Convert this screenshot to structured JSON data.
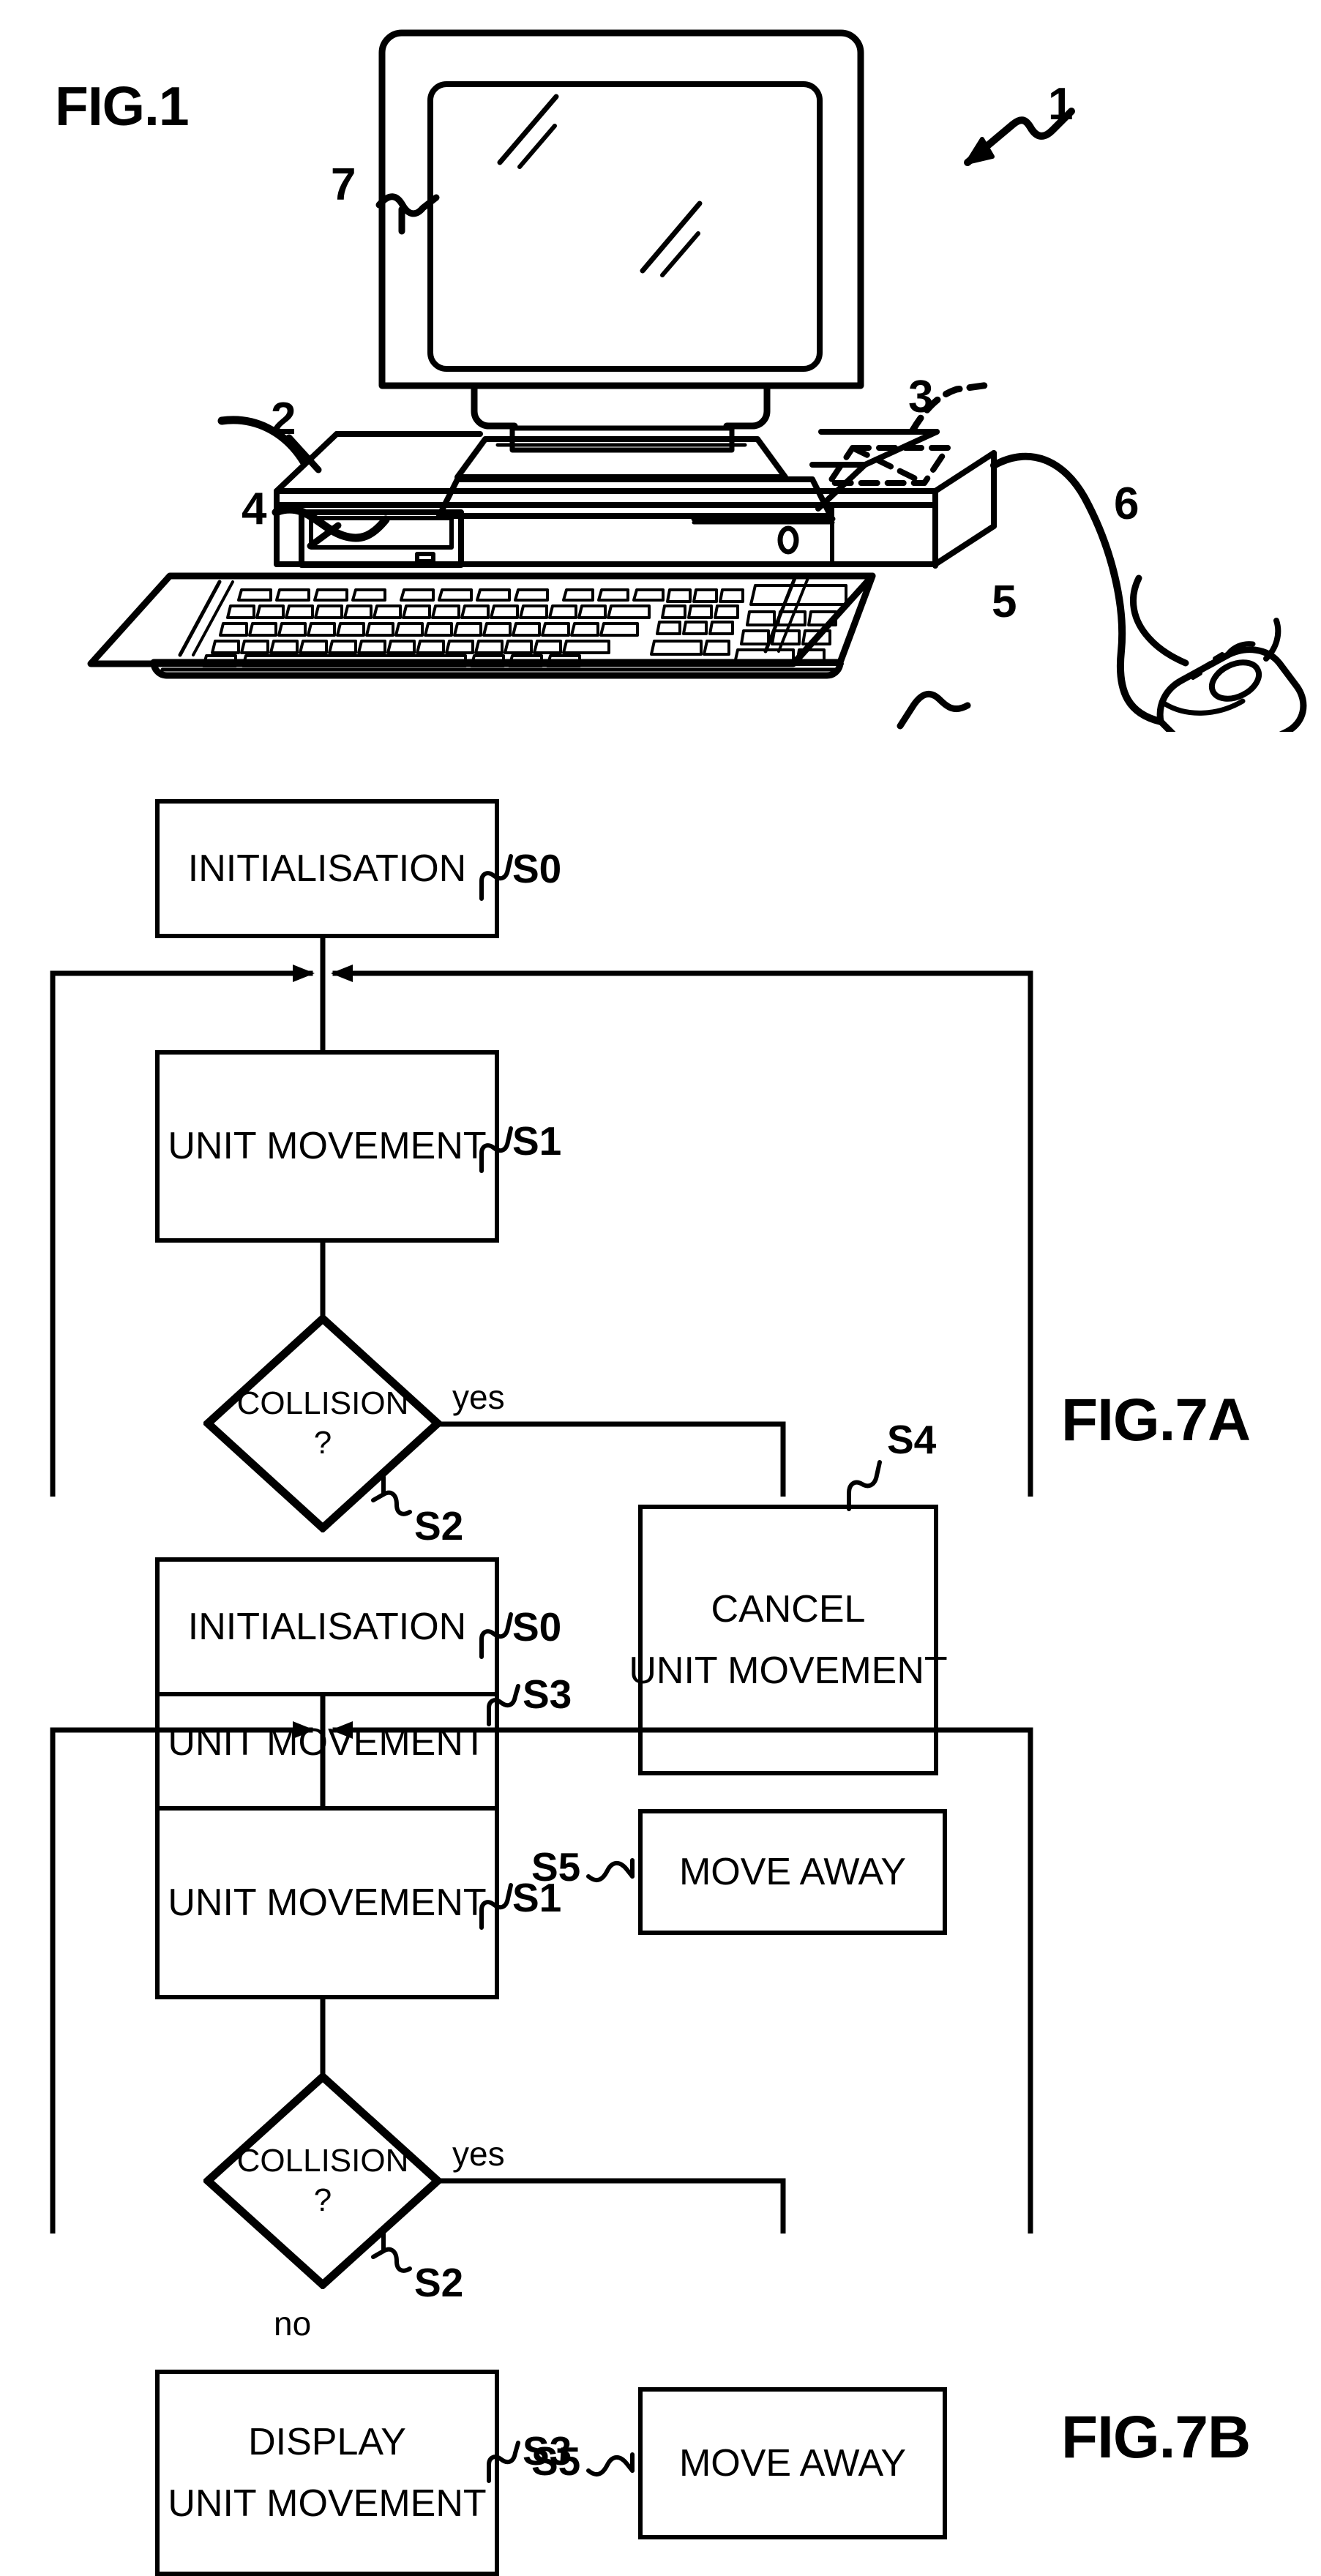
{
  "document": {
    "type": "patent-drawing-sheet",
    "figures": [
      "FIG.1",
      "FIG.7A",
      "FIG.7B"
    ]
  },
  "fig1": {
    "label": "FIG.1",
    "reference_numerals": [
      {
        "id": "1",
        "text": "1",
        "points_to": "whole computer system"
      },
      {
        "id": "2",
        "text": "2",
        "points_to": "computer base unit / housing"
      },
      {
        "id": "3",
        "text": "3",
        "points_to": "internal component (dashed outline)"
      },
      {
        "id": "4",
        "text": "4",
        "points_to": "disk drive slot"
      },
      {
        "id": "5",
        "text": "5",
        "points_to": "keyboard"
      },
      {
        "id": "6",
        "text": "6",
        "points_to": "mouse"
      },
      {
        "id": "7",
        "text": "7",
        "points_to": "monitor / display screen"
      }
    ]
  },
  "fig7a": {
    "label": "FIG.7A",
    "nodes": [
      {
        "step": "S0",
        "kind": "process",
        "lines": [
          "INITIALISATION"
        ]
      },
      {
        "step": "S1",
        "kind": "process",
        "lines": [
          "UNIT MOVEMENT"
        ]
      },
      {
        "step": "S2",
        "kind": "decision",
        "lines": [
          "COLLISION",
          "?"
        ]
      },
      {
        "step": "S3",
        "kind": "process",
        "lines": [
          "DISPLAY",
          "UNIT MOVEMENT"
        ]
      },
      {
        "step": "S4",
        "kind": "process",
        "lines": [
          "CANCEL",
          "UNIT MOVEMENT"
        ]
      },
      {
        "step": "S5",
        "kind": "process",
        "lines": [
          "MOVE AWAY"
        ]
      }
    ],
    "branch_labels": {
      "yes": "yes",
      "no": "no"
    },
    "step_labels": {
      "s0": "S0",
      "s1": "S1",
      "s2": "S2",
      "s3": "S3",
      "s4": "S4",
      "s5": "S5"
    },
    "box_text": {
      "initialisation": "INITIALISATION",
      "unit_movement": "UNIT MOVEMENT",
      "collision": "COLLISION",
      "question_mark": "?",
      "display_l1": "DISPLAY",
      "display_l2": "UNIT MOVEMENT",
      "cancel_l1": "CANCEL",
      "cancel_l2": "UNIT MOVEMENT",
      "move_away": "MOVE AWAY"
    }
  },
  "fig7b": {
    "label": "FIG.7B",
    "nodes": [
      {
        "step": "S0",
        "kind": "process",
        "lines": [
          "INITIALISATION"
        ]
      },
      {
        "step": "S1",
        "kind": "process",
        "lines": [
          "UNIT MOVEMENT"
        ]
      },
      {
        "step": "S2",
        "kind": "decision",
        "lines": [
          "COLLISION",
          "?"
        ]
      },
      {
        "step": "S3",
        "kind": "process",
        "lines": [
          "DISPLAY",
          "UNIT MOVEMENT"
        ]
      },
      {
        "step": "S5",
        "kind": "process",
        "lines": [
          "MOVE AWAY"
        ]
      }
    ],
    "branch_labels": {
      "yes": "yes",
      "no": "no"
    },
    "step_labels": {
      "s0": "S0",
      "s1": "S1",
      "s2": "S2",
      "s3": "S3",
      "s5": "S5"
    },
    "box_text": {
      "initialisation": "INITIALISATION",
      "unit_movement": "UNIT MOVEMENT",
      "collision": "COLLISION",
      "question_mark": "?",
      "display_l1": "DISPLAY",
      "display_l2": "UNIT MOVEMENT",
      "move_away": "MOVE AWAY"
    }
  },
  "colors": {
    "ink": "#000000",
    "paper": "#ffffff"
  }
}
